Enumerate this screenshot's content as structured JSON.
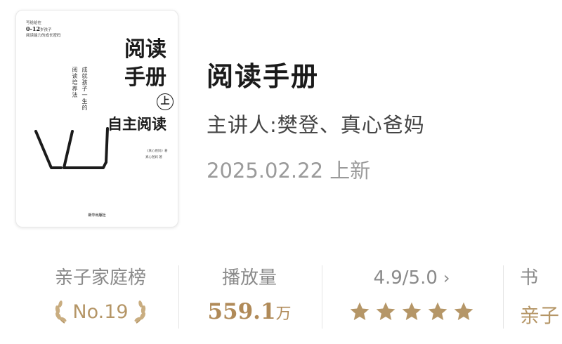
{
  "cover": {
    "top_line1": "写给给在",
    "top_line2_big": "0-12",
    "top_line2_rest": "岁孩子",
    "top_line3": "阅读能力的成长密码",
    "title_line1": "阅读",
    "title_line2": "手册",
    "volume": "上",
    "subtitle": "自主阅读",
    "vertical_1": "成就孩子一生的",
    "vertical_2": "阅读培养法",
    "author_line1": "《真心爸妈》著",
    "author_line2": "真心爸妈 著",
    "publisher": "新华出版社"
  },
  "book": {
    "title": "阅读手册",
    "speaker": "主讲人:樊登、真心爸妈",
    "date": "2025.02.22 上新"
  },
  "stats": {
    "ranking": {
      "label": "亲子家庭榜",
      "value": "No.19"
    },
    "plays": {
      "label": "播放量",
      "number": "559.1",
      "unit": "万"
    },
    "rating": {
      "label": "4.9/5.0",
      "chevron": "›",
      "stars": 5
    },
    "fourth": {
      "label": "书",
      "value": "亲子"
    }
  },
  "colors": {
    "gold": "#b59667",
    "gray": "#8a8a8a"
  }
}
